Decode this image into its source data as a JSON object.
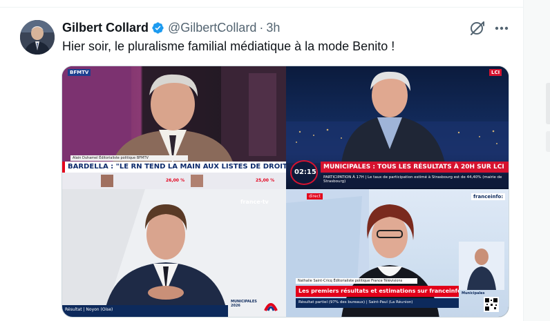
{
  "tweet": {
    "display_name": "Gilbert Collard",
    "handle": "@GilbertCollard",
    "separator": "·",
    "time": "3h",
    "text": "Hier soir, le pluralisme familial médiatique à la mode Benito !",
    "verified": true,
    "more_icon": "ellipsis-icon",
    "grok_icon": "grok-icon"
  },
  "media": {
    "panel_bfmtv": {
      "channel": "BFMTV",
      "caption": "Alain Duhamel Éditorialiste politique BFMTV",
      "headline": "BARDELLA : \"LE RN TEND LA MAIN AUX LISTES DE DROITE\"",
      "percent_left": "26,00 %",
      "percent_right": "25,00 %"
    },
    "panel_lci": {
      "channel": "LCI",
      "clock": "02:15",
      "headline": "MUNICIPALES : TOUS LES RÉSULTATS À 20H SUR LCI",
      "sub": "PARTICIPATION À 17H | Le taux de participation estimé à Strasbourg est de 44,40% (mairie de Strasbourg)"
    },
    "panel_france_tv": {
      "channel": "france·tv",
      "ticker": "Résultat | Noyon (Oise)",
      "badge": "MUNICIPALES 2026"
    },
    "panel_franceinfo": {
      "channel": "franceinfo:",
      "live": "direct",
      "caption": "Nathalie Saint-Cricq Éditorialiste politique France Télévisions",
      "headline": "Les premiers résultats et estimations sur franceinfo",
      "ticker": "Résultat partiel (97% des bureaux) | Saint-Paul (La Réunion)",
      "side_label": "Municipales"
    }
  },
  "colors": {
    "accent_blue": "#1d9bf0",
    "text_primary": "#0f1419",
    "text_secondary": "#536471",
    "bfm_red": "#e3001b",
    "lci_red": "#d6122f"
  }
}
